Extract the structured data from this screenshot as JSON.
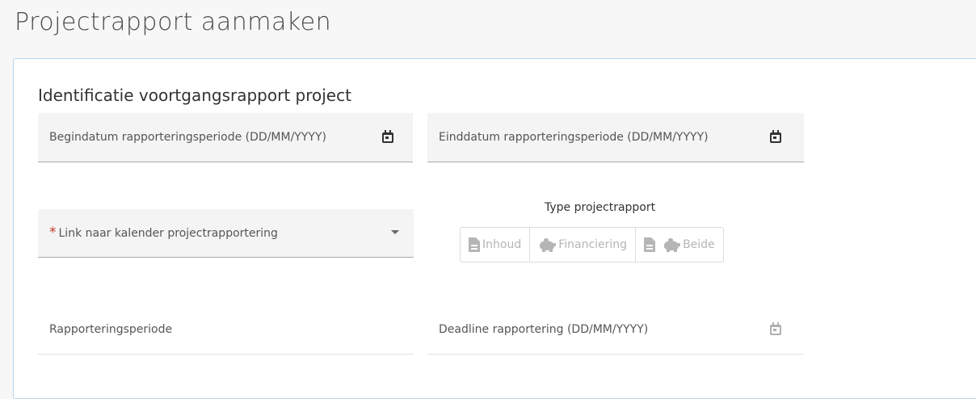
{
  "page": {
    "title": "Projectrapport aanmaken"
  },
  "section": {
    "title": "Identificatie voortgangsrapport project"
  },
  "fields": {
    "begindatum": {
      "label": "Begindatum rapporteringsperiode (DD/MM/YYYY)",
      "icon": "calendar-icon"
    },
    "einddatum": {
      "label": "Einddatum rapporteringsperiode (DD/MM/YYYY)",
      "icon": "calendar-icon"
    },
    "link_kalender": {
      "required_mark": "*",
      "label": "Link naar kalender projectrapportering",
      "icon": "caret-down-icon"
    },
    "rapporteringsperiode": {
      "label": "Rapporteringsperiode"
    },
    "deadline": {
      "label": "Deadline rapportering (DD/MM/YYYY)",
      "icon": "calendar-icon"
    }
  },
  "type_projectrapport": {
    "label": "Type projectrapport",
    "options": [
      {
        "label": "Inhoud",
        "icons": [
          "document-icon"
        ]
      },
      {
        "label": "Financiering",
        "icons": [
          "piggy-bank-icon"
        ]
      },
      {
        "label": "Beide",
        "icons": [
          "document-icon",
          "piggy-bank-icon"
        ]
      }
    ],
    "disabled_color": "#b5b5b5"
  },
  "colors": {
    "required": "#c0392b",
    "card_border": "#b9d6ec"
  }
}
